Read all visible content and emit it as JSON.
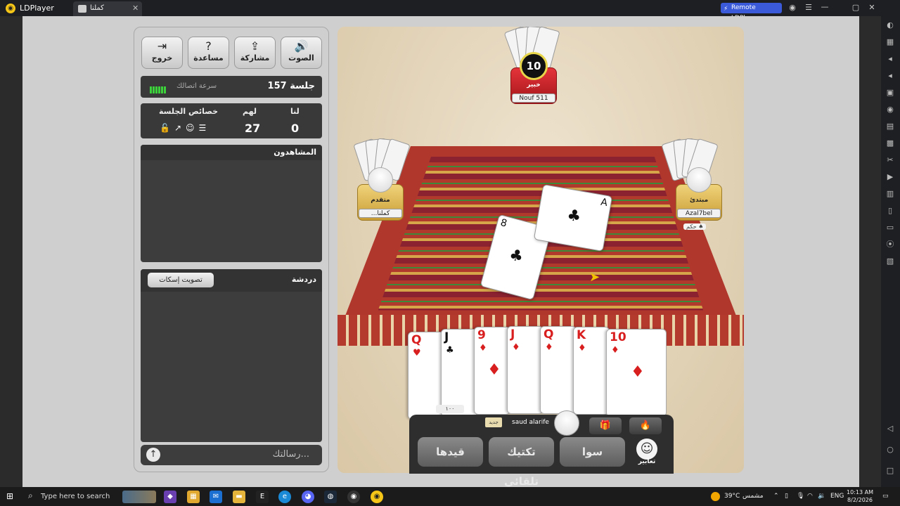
{
  "window": {
    "app_name": "LDPlayer",
    "tab_label": "كملنا",
    "tab_close": "✕",
    "remote_label": "Remote LDPlayer",
    "controls": [
      "◉",
      "☰",
      "—",
      "▢",
      "✕"
    ]
  },
  "toolbar_buttons": [
    {
      "id": "exit",
      "label": "خروج",
      "icon": "⇥"
    },
    {
      "id": "help",
      "label": "مساعدة",
      "icon": "?"
    },
    {
      "id": "share",
      "label": "مشاركة",
      "icon": "⇪"
    },
    {
      "id": "sound",
      "label": "الصوت",
      "icon": "🔊"
    }
  ],
  "connection": {
    "speed_label": "سرعة اتصالك",
    "session_label": "جلسة 157"
  },
  "score": {
    "properties_header": "خصائص الجلسة",
    "them_header": "لهم",
    "us_header": "لنا",
    "them_value": "27",
    "us_value": "0",
    "property_icons": "🔓↗☺☰"
  },
  "viewers": {
    "title": "المشاهدون"
  },
  "chat": {
    "title": "دردشة",
    "mute_button": "تصويت إسكات",
    "placeholder": "رسالتك...",
    "send_icon": "↑"
  },
  "players": {
    "top": {
      "title": "خبير",
      "name": "Nouf 511",
      "timer": "10"
    },
    "left": {
      "title": "متقدم",
      "name": "...كملنا"
    },
    "right": {
      "title": "مبتدئ",
      "name": "Azal7bel",
      "badge": "حكم ♠"
    }
  },
  "table_cards": [
    {
      "rank": "8",
      "suit": "♣"
    },
    {
      "rank": "A",
      "suit": "♣"
    }
  ],
  "hand_cards": [
    {
      "rank": "Q",
      "suit": "♥",
      "color": "red"
    },
    {
      "rank": "J",
      "suit": "♣",
      "color": "black"
    },
    {
      "rank": "9",
      "suit": "♦",
      "color": "red"
    },
    {
      "rank": "J",
      "suit": "♦",
      "color": "red"
    },
    {
      "rank": "Q",
      "suit": "♦",
      "color": "red"
    },
    {
      "rank": "K",
      "suit": "♦",
      "color": "red"
    },
    {
      "rank": "10",
      "suit": "♦",
      "color": "red"
    }
  ],
  "hand_points": "١٠٠",
  "controls": {
    "me_name": "saud alarife",
    "new_badge": "جديد",
    "buttons": [
      "قيدها",
      "تكتيك تلقائي",
      "سوا"
    ],
    "emoji_label": "تعابير",
    "gift_icon": "🎁",
    "fire_icon": "🔥"
  },
  "taskbar": {
    "search_placeholder": "Type here to search",
    "weather_temp": "39°C",
    "weather_desc": "مشمس",
    "lang": "ENG",
    "time": "10:13 AM",
    "date": "8/2/2026"
  },
  "colors": {
    "accent": "#3a5ad9",
    "signal_green": "#3bd23b",
    "table_red": "#b0372c"
  }
}
